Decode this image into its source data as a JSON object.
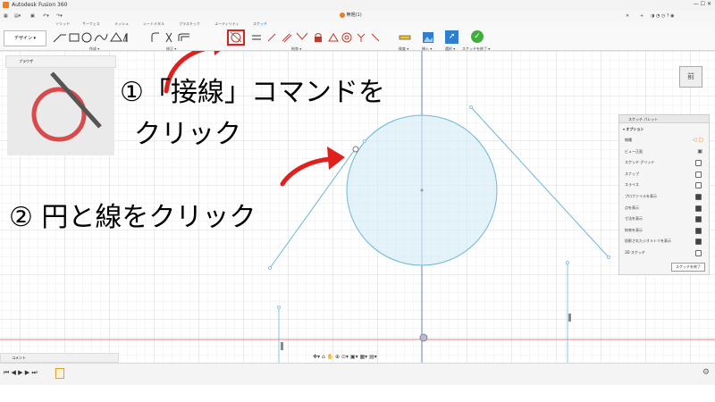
{
  "app": {
    "title": "Autodesk Fusion 360",
    "doc_title": "無題(1)",
    "doc_version": "v1"
  },
  "tabs": [
    "ソリッド",
    "サーフェス",
    "メッシュ",
    "シートメタル",
    "プラスチック",
    "ユーティリティ",
    "スケッチ"
  ],
  "active_tab": "スケッチ",
  "toolbar": {
    "design_label": "デザイン ▾",
    "groups": {
      "create": "作成 ▾",
      "modify": "修正 ▾",
      "constraints": "拘束 ▾",
      "inspect": "検査 ▾",
      "insert": "挿入 ▾",
      "select": "選択 ▾",
      "finish": "スケッチを終了 ▾"
    }
  },
  "browser": {
    "label": "ブラウザ"
  },
  "viewcube": {
    "label": "前"
  },
  "palette": {
    "title": "スケッチ パレット",
    "section": "▾ オプション",
    "rows": [
      {
        "label": "線種",
        "type": "icons"
      },
      {
        "label": "ビュー正面",
        "type": "icon"
      },
      {
        "label": "スケッチ グリッド",
        "checked": false
      },
      {
        "label": "スナップ",
        "checked": false
      },
      {
        "label": "スライス",
        "checked": false
      },
      {
        "label": "プロファイルを表示",
        "checked": true
      },
      {
        "label": "点を表示",
        "checked": true
      },
      {
        "label": "寸法を表示",
        "checked": true
      },
      {
        "label": "拘束を表示",
        "checked": true
      },
      {
        "label": "投影されたジオメトリを表示",
        "checked": true
      },
      {
        "label": "3D スケッチ",
        "checked": false
      }
    ],
    "finish_button": "スケッチを終了"
  },
  "comments": {
    "label": "コメント"
  },
  "annotations": {
    "step1_line1": "①「接線」コマンドを",
    "step1_line2": "クリック",
    "step2": "② 円と線をクリック"
  },
  "colors": {
    "highlight": "#e0201c",
    "sketch": "#6fb6d9",
    "origin_x": "#e05656"
  }
}
